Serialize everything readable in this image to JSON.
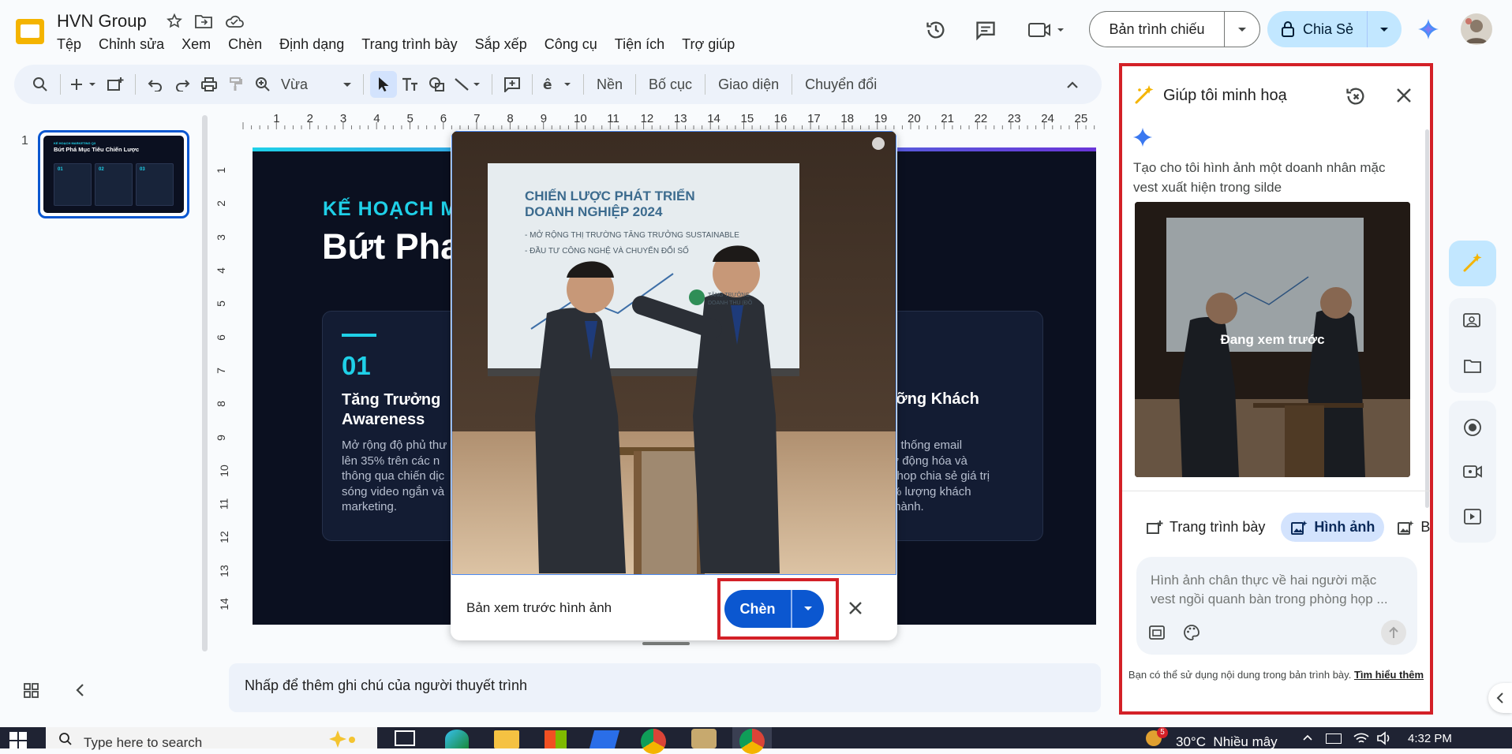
{
  "app": {
    "doc_title": "HVN Group",
    "menu": [
      "Tệp",
      "Chỉnh sửa",
      "Xem",
      "Chèn",
      "Định dạng",
      "Trang trình bày",
      "Sắp xếp",
      "Công cụ",
      "Tiện ích",
      "Trợ giúp"
    ],
    "slideshow_label": "Bản trình chiếu",
    "share_label": "Chia Sẻ"
  },
  "toolbar": {
    "zoom_label": "Vừa",
    "background_label": "Nền",
    "layout_label": "Bố cục",
    "theme_label": "Giao diện",
    "transition_label": "Chuyển đổi"
  },
  "filmstrip": {
    "slide_number": "1",
    "thumb_kicker": "KẾ HOẠCH MARKETING Q3",
    "thumb_title": "Bứt Phá Mục Tiêu Chiến Lược",
    "thumb_nums": [
      "01",
      "02",
      "03"
    ]
  },
  "ruler": {
    "h_ticks": [
      "1",
      "2",
      "3",
      "4",
      "5",
      "6",
      "7",
      "8",
      "9",
      "10",
      "11",
      "12",
      "13",
      "14",
      "15",
      "16",
      "17",
      "18",
      "19",
      "20",
      "21",
      "22",
      "23",
      "24",
      "25"
    ],
    "v_ticks": [
      "1",
      "2",
      "3",
      "4",
      "5",
      "6",
      "7",
      "8",
      "9",
      "10",
      "11",
      "12",
      "13",
      "14"
    ]
  },
  "slide": {
    "kicker": "KẾ HOẠCH M",
    "title": "Bứt Pha",
    "card1_num": "01",
    "card1_title_1": "Tăng Trưởng",
    "card1_title_2": "Awareness",
    "card1_body": [
      "Mở rộng độ phủ thư",
      "lên 35% trên các n",
      "thông qua chiến dịc",
      "sóng video ngắn và",
      "marketing."
    ],
    "card3_title": "ưỡng Khách",
    "card3_body": [
      "ệ thống email",
      "ự động hóa và",
      "shop chia sẻ giá trị",
      "% lượng khách",
      "thành."
    ]
  },
  "preview": {
    "image_heading_1": "CHIẾN LƯỢC PHÁT TRIỂN",
    "image_heading_2": "DOANH NGHIỆP 2024",
    "image_bullet_1": "- MỞ RỘNG THỊ TRƯỜNG TĂNG TRƯỞNG SUSTAINABLE",
    "image_bullet_2": "- ĐẦU TƯ CÔNG NGHỆ VÀ CHUYỂN ĐỔI SỐ",
    "image_badge_1": "TĂNG TRƯỞNG",
    "image_badge_2": "DOANH THU (ĐỒ",
    "caption": "Bản xem trước hình ảnh",
    "insert_label": "Chèn"
  },
  "notes": {
    "placeholder": "Nhấp để thêm ghi chú của người thuyết trình"
  },
  "panel": {
    "title": "Giúp tôi minh hoạ",
    "prompt": "Tạo cho tôi hình ảnh một doanh nhân mặc vest xuất hiện trong silde",
    "preview_status": "Đang xem trước",
    "tabs": [
      "Trang trình bày",
      "Hình ảnh",
      "B"
    ],
    "input_placeholder": "Hình ảnh chân thực về hai người mặc vest ngồi quanh bàn trong phòng họp ...",
    "footer_text": "Bạn có thể sử dụng nội dung trong bản trình bày.",
    "footer_link": "Tìm hiểu thêm"
  },
  "taskbar": {
    "search_placeholder": "Type here to search",
    "notification_count": "5",
    "weather": "30°C  Nhiều mây",
    "time": "4:32 PM"
  },
  "colors": {
    "accent_blue": "#0b57d0",
    "share_bg": "#c2e7ff",
    "highlight_red": "#d32027",
    "slide_cyan": "#1fd0e8"
  }
}
